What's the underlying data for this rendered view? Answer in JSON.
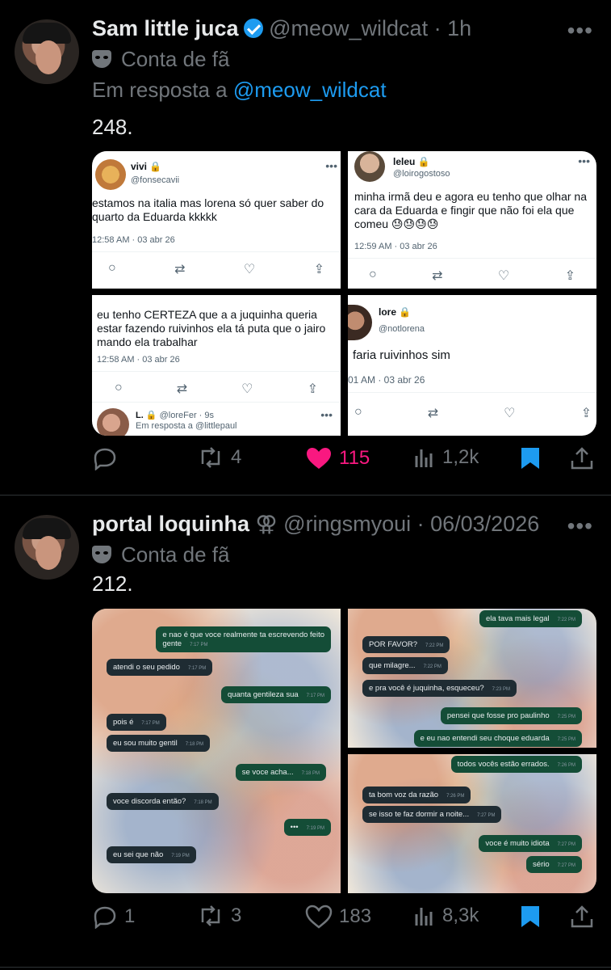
{
  "posts": [
    {
      "name": "Sam little juca",
      "handle": "@meow_wildcat",
      "time": "· 1h",
      "badge": "Conta de fã",
      "reply_prefix": "Em resposta a",
      "reply_handle": "@meow_wildcat",
      "text": "248.",
      "stats": {
        "replies": "",
        "reposts": "4",
        "likes": "115",
        "views": "1,2k"
      },
      "screens": [
        {
          "name": "vivi",
          "handle": "@fonsecavii",
          "text": "estamos na italia mas lorena só quer saber do quarto da Eduarda kkkkk",
          "time": "12:58 AM · 03 abr 26"
        },
        {
          "name": "leleu",
          "handle": "@loirogostoso",
          "text": "minha irmã deu e agora eu tenho  que olhar na cara da Eduarda e fingir que não foi ela que comeu 😓😓😓😓",
          "time": "12:59 AM · 03 abr 26"
        },
        {
          "text": "eu tenho CERTEZA que a a juquinha queria estar fazendo ruivinhos ela tá puta que o jairo mando ela trabalhar",
          "time": "12:58 AM · 03 abr 26",
          "sub_name": "L.",
          "sub_handle": "@loreFer · 9s",
          "sub_reply": "Em resposta a @littlepaul"
        },
        {
          "name": "lore",
          "handle": "@notlorena",
          "text": "faria ruivinhos sim",
          "time": "01 AM · 03 abr 26"
        }
      ]
    },
    {
      "name": "portal loquinha",
      "handle": "@ringsmyoui",
      "time": "· 06/03/2026",
      "badge": "Conta de fã",
      "text": "212.",
      "stats": {
        "replies": "1",
        "reposts": "3",
        "likes": "183",
        "views": "8,3k"
      },
      "chat_left": [
        {
          "text": "e nao é que voce realmente ta escrevendo feito",
          "text2": "gente",
          "time": "7:17 PM",
          "out": true
        },
        {
          "text": "atendi o seu pedido",
          "time": "7:17 PM",
          "out": false
        },
        {
          "text": "quanta gentileza sua",
          "time": "7:17 PM",
          "out": true
        },
        {
          "text": "pois é",
          "time": "7:17 PM",
          "out": false
        },
        {
          "text": "eu sou muito gentil",
          "time": "7:18 PM",
          "out": false
        },
        {
          "text": "se voce acha...",
          "time": "7:18 PM",
          "out": true
        },
        {
          "text": "voce discorda então?",
          "time": "7:18 PM",
          "out": false
        },
        {
          "text": "•••",
          "time": "7:19 PM",
          "out": true
        },
        {
          "text": "eu sei que não",
          "time": "7:19 PM",
          "out": false
        }
      ],
      "chat_right_top": [
        {
          "text": "ela tava mais legal",
          "time": "7:22 PM",
          "out": true
        },
        {
          "text": "POR FAVOR?",
          "time": "7:22 PM",
          "out": false
        },
        {
          "text": "que milagre...",
          "time": "7:22 PM",
          "out": false
        },
        {
          "text": "e pra você é juquinha, esqueceu?",
          "time": "7:23 PM",
          "out": false
        },
        {
          "text": "pensei que fosse pro paulinho",
          "time": "7:25 PM",
          "out": true
        },
        {
          "text": "e eu nao entendi seu choque eduarda",
          "time": "7:25 PM",
          "out": true
        }
      ],
      "chat_right_bottom": [
        {
          "text": "todos vocês estão errados.",
          "time": "7:26 PM",
          "out": true
        },
        {
          "text": "ta bom voz da razão",
          "time": "7:26 PM",
          "out": false
        },
        {
          "text": "se isso te faz dormir a noite...",
          "time": "7:27 PM",
          "out": false
        },
        {
          "text": "voce é muito idiota",
          "time": "7:27 PM",
          "out": true
        },
        {
          "text": "sério",
          "time": "7:27 PM",
          "out": true
        }
      ]
    }
  ],
  "colors": {
    "like_active": "#f91880",
    "bookmark_active": "#1d9bf0",
    "link": "#1d9bf0"
  },
  "icons": [
    "verified-icon",
    "mask-icon",
    "reply-icon",
    "repost-icon",
    "heart-icon",
    "views-icon",
    "bookmark-icon",
    "share-icon",
    "more-icon"
  ]
}
